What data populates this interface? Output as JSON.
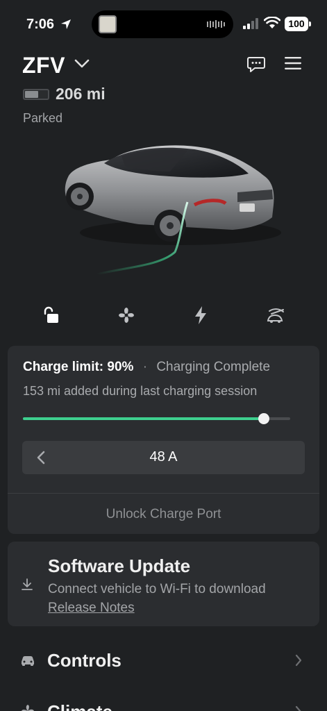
{
  "status_bar": {
    "time": "7:06",
    "battery_level": "100",
    "location_icon": "location-arrow-icon",
    "signal_icon": "cellular-signal-icon",
    "wifi_icon": "wifi-icon"
  },
  "header": {
    "vehicle_name": "ZFV",
    "range": "206 mi",
    "battery_fill_fraction": 0.55,
    "status": "Parked",
    "icons": [
      "chevron-down-icon",
      "message-icon",
      "menu-icon"
    ]
  },
  "quick_actions": [
    {
      "name": "lock",
      "icon": "unlock-icon"
    },
    {
      "name": "climate",
      "icon": "fan-icon"
    },
    {
      "name": "charge",
      "icon": "bolt-icon"
    },
    {
      "name": "summon",
      "icon": "summon-icon"
    }
  ],
  "charging": {
    "limit_label": "Charge limit:",
    "limit_value": "90%",
    "separator": "·",
    "status": "Charging Complete",
    "session_text": "153 mi added during last charging session",
    "slider_percent": 90,
    "amperage": "48 A",
    "unlock_port_label": "Unlock Charge Port"
  },
  "software_update": {
    "title": "Software Update",
    "subtitle": "Connect vehicle to Wi-Fi to download",
    "release_notes": "Release Notes"
  },
  "menu": {
    "items": [
      {
        "label": "Controls",
        "icon": "car-icon"
      },
      {
        "label": "Climate",
        "icon": "fan-icon"
      }
    ]
  },
  "colors": {
    "background": "#1f2123",
    "card": "#2b2d30",
    "accent_green": "#3ecf8e"
  }
}
